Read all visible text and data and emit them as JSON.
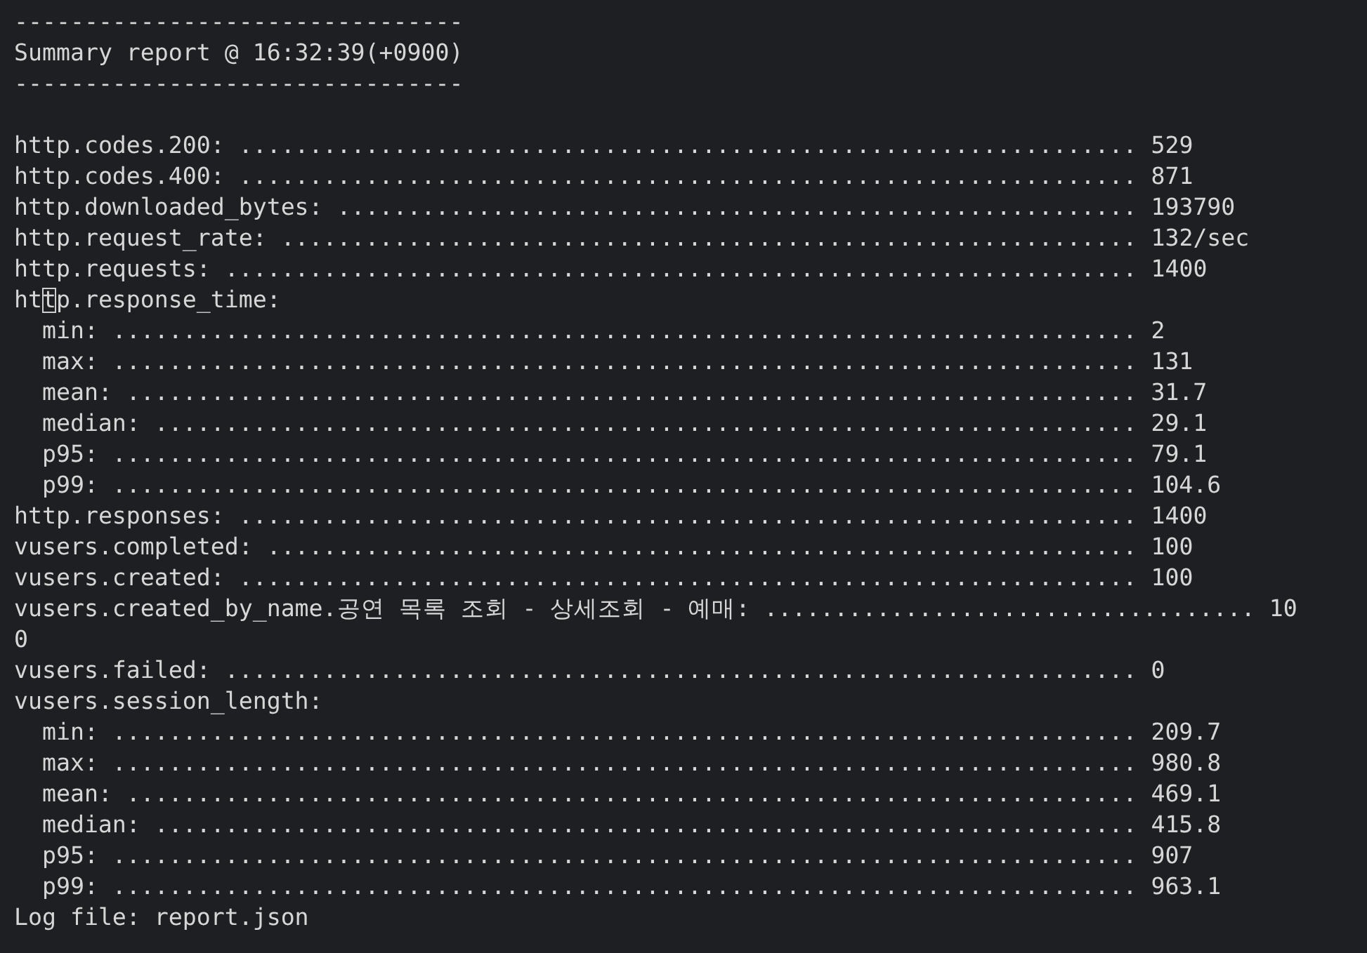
{
  "lines": [
    {
      "kind": "rule",
      "text": "--------------------------------"
    },
    {
      "kind": "text",
      "text": "Summary report @ 16:32:39(+0900)"
    },
    {
      "kind": "rule",
      "text": "--------------------------------"
    },
    {
      "kind": "blank"
    },
    {
      "kind": "metric",
      "label": "http.codes.200:",
      "leader": "................................................................",
      "value": "529"
    },
    {
      "kind": "metric",
      "label": "http.codes.400:",
      "leader": "................................................................",
      "value": "871"
    },
    {
      "kind": "metric",
      "label": "http.downloaded_bytes:",
      "leader": ".........................................................",
      "value": "193790"
    },
    {
      "kind": "metric",
      "label": "http.request_rate:",
      "leader": ".............................................................",
      "value": "132/sec"
    },
    {
      "kind": "metric",
      "label": "http.requests:",
      "leader": ".................................................................",
      "value": "1400"
    },
    {
      "kind": "group",
      "label": "http.response_time:",
      "cursor": true,
      "children": [
        {
          "label": "min:",
          "leader": ".........................................................................",
          "value": "2"
        },
        {
          "label": "max:",
          "leader": ".........................................................................",
          "value": "131"
        },
        {
          "label": "mean:",
          "leader": "........................................................................",
          "value": "31.7"
        },
        {
          "label": "median:",
          "leader": "......................................................................",
          "value": "29.1"
        },
        {
          "label": "p95:",
          "leader": ".........................................................................",
          "value": "79.1"
        },
        {
          "label": "p99:",
          "leader": ".........................................................................",
          "value": "104.6"
        }
      ]
    },
    {
      "kind": "metric",
      "label": "http.responses:",
      "leader": "................................................................",
      "value": "1400"
    },
    {
      "kind": "metric",
      "label": "vusers.completed:",
      "leader": "..............................................................",
      "value": "100"
    },
    {
      "kind": "metric",
      "label": "vusers.created:",
      "leader": "................................................................",
      "value": "100"
    },
    {
      "kind": "metric",
      "label": "vusers.created_by_name.공연 목록 조회 - 상세조회 - 예매:",
      "leader": "...................................",
      "value": "10"
    },
    {
      "kind": "text",
      "text": "0"
    },
    {
      "kind": "metric",
      "label": "vusers.failed:",
      "leader": ".................................................................",
      "value": "0"
    },
    {
      "kind": "group",
      "label": "vusers.session_length:",
      "children": [
        {
          "label": "min:",
          "leader": ".........................................................................",
          "value": "209.7"
        },
        {
          "label": "max:",
          "leader": ".........................................................................",
          "value": "980.8"
        },
        {
          "label": "mean:",
          "leader": "........................................................................",
          "value": "469.1"
        },
        {
          "label": "median:",
          "leader": "......................................................................",
          "value": "415.8"
        },
        {
          "label": "p95:",
          "leader": ".........................................................................",
          "value": "907"
        },
        {
          "label": "p99:",
          "leader": ".........................................................................",
          "value": "963.1"
        }
      ]
    },
    {
      "kind": "text",
      "text": "Log file: report.json"
    }
  ]
}
